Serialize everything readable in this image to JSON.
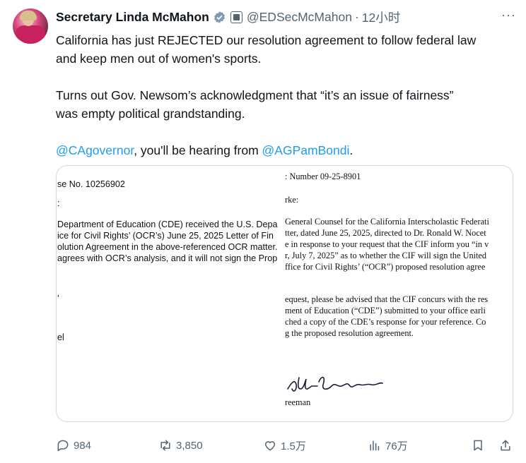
{
  "author": {
    "name": "Secretary Linda McMahon",
    "handle": "@EDSecMcMahon",
    "separator": "·",
    "time": "12小时"
  },
  "more_label": "···",
  "tweet": {
    "line1": "California has just REJECTED our resolution agreement to follow federal law",
    "line2": "and keep men out of women's sports.",
    "line3": "Turns out Gov. Newsom’s acknowledgment that “it’s an issue of fairness”",
    "line4": "was empty political grandstanding.",
    "mention1": "@CAgovernor",
    "mid_text": ", you'll be hearing from ",
    "mention2": "@AGPamBondi",
    "end_text": "."
  },
  "document": {
    "left": {
      "case_no": "se No. 10256902",
      "colon": ":",
      "p1": "Department of Education (CDE) received the U.S. Depa",
      "p2": "ice for Civil Rights’ (OCR’s) June 25, 2025 Letter of Fin",
      "p3": "olution Agreement in the above-referenced OCR matter.",
      "p4": "agrees with OCR’s analysis, and it will not sign the Prop",
      "tick": "’",
      "el": "el"
    },
    "right": {
      "number": ": Number 09-25-8901",
      "salutation": "rke:",
      "r1": "General Counsel for the California Interscholastic Federati",
      "r2": "tter, dated June 25, 2025, directed to Dr. Ronald W. Nocet",
      "r3": "e in response to your request that the CIF inform you “in v",
      "r4": "r, July 7, 2025” as to whether the CIF will sign the United",
      "r5": "ffice for Civil Rights’ (“OCR”) proposed resolution agree",
      "r6": "equest, please be advised that the CIF concurs with the res",
      "r7": "ment of Education (“CDE”) submitted to your office earli",
      "r8": "ched a copy of the CDE’s response for your reference.  Co",
      "r9": "g the proposed resolution agreement.",
      "signer": "reeman"
    }
  },
  "actions": {
    "replies": "984",
    "reposts": "3,850",
    "likes": "1.5万",
    "views": "76万"
  },
  "colors": {
    "link": "#1d9bf0",
    "secondary": "#536471",
    "verified_badge": "#829aab",
    "border": "#cfd9de"
  },
  "icons": [
    "verified-badge-icon",
    "government-badge-icon",
    "reply-icon",
    "repost-icon",
    "like-icon",
    "views-icon",
    "bookmark-icon",
    "share-icon"
  ]
}
